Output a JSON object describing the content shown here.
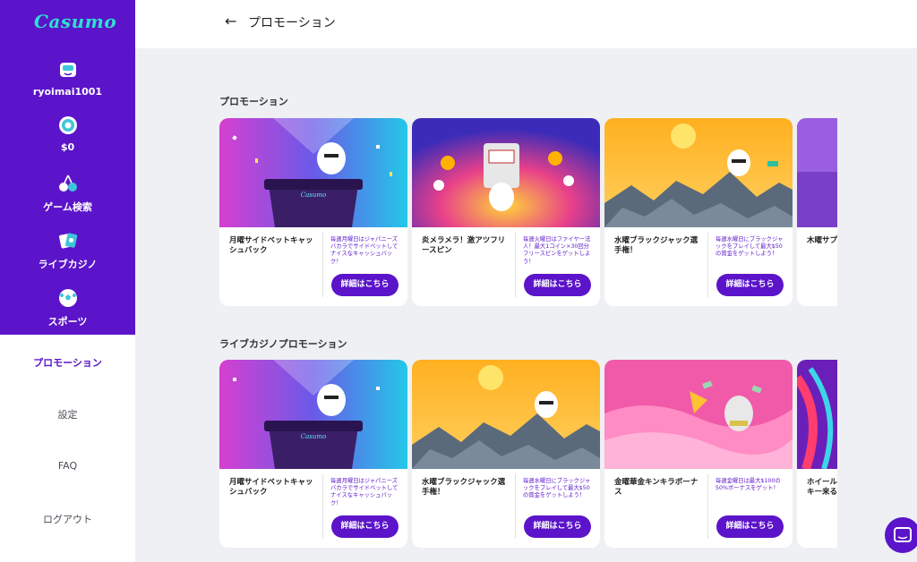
{
  "sidebar": {
    "logo": "Casumo",
    "username": "ryoimai1001",
    "balance": "$0",
    "items": [
      {
        "label": "ゲーム検索",
        "icon": "cherries-icon"
      },
      {
        "label": "ライブカジノ",
        "icon": "cards-icon"
      },
      {
        "label": "スポーツ",
        "icon": "soccer-ball-icon"
      }
    ],
    "links": [
      "プロモーション",
      "設定",
      "FAQ",
      "ログアウト"
    ]
  },
  "header": {
    "title": "プロモーション",
    "back_icon": "arrow-left-icon"
  },
  "sections": [
    {
      "title": "プロモーション",
      "cards": [
        {
          "title": "月曜サイドベットキャッシュバック",
          "desc": "毎週月曜日はジャパニーズバカラでサイドベットしてナイスなキャッシュバック！",
          "button": "詳細はこちら"
        },
        {
          "title": "炎メラメラ！激アツフリースピン",
          "desc": "毎週火曜日はファイヤー法人！最大1コイン×30回分フリースピンをゲットしよう！",
          "button": "詳細はこちら"
        },
        {
          "title": "水曜ブラックジャック選手権！",
          "desc": "毎週水曜日にブラックジャックをプレイして最大$50の賞金をゲットしよう！",
          "button": "詳細はこちら"
        },
        {
          "title": "木曜サプ",
          "desc": "",
          "button": ""
        }
      ]
    },
    {
      "title": "ライブカジノプロモーション",
      "cards": [
        {
          "title": "月曜サイドベットキャッシュバック",
          "desc": "毎週月曜日はジャパニーズバカラでサイドベットしてナイスなキャッシュバック！",
          "button": "詳細はこちら"
        },
        {
          "title": "水曜ブラックジャック選手権！",
          "desc": "毎週水曜日にブラックジャックをプレイして最大$50の賞金をゲットしよう！",
          "button": "詳細はこちら"
        },
        {
          "title": "金曜華金キンキラボーナス",
          "desc": "毎週金曜日は最大$100の50%ボーナスをゲット！",
          "button": "詳細はこちら"
        },
        {
          "title": "ホイール キー来る",
          "desc": "",
          "button": ""
        }
      ]
    }
  ],
  "colors": {
    "brand_purple": "#5b14c9",
    "logo_teal": "#2fe0d0",
    "page_bg": "#eef0f3"
  },
  "chat_icon": "chat-bubble-icon"
}
